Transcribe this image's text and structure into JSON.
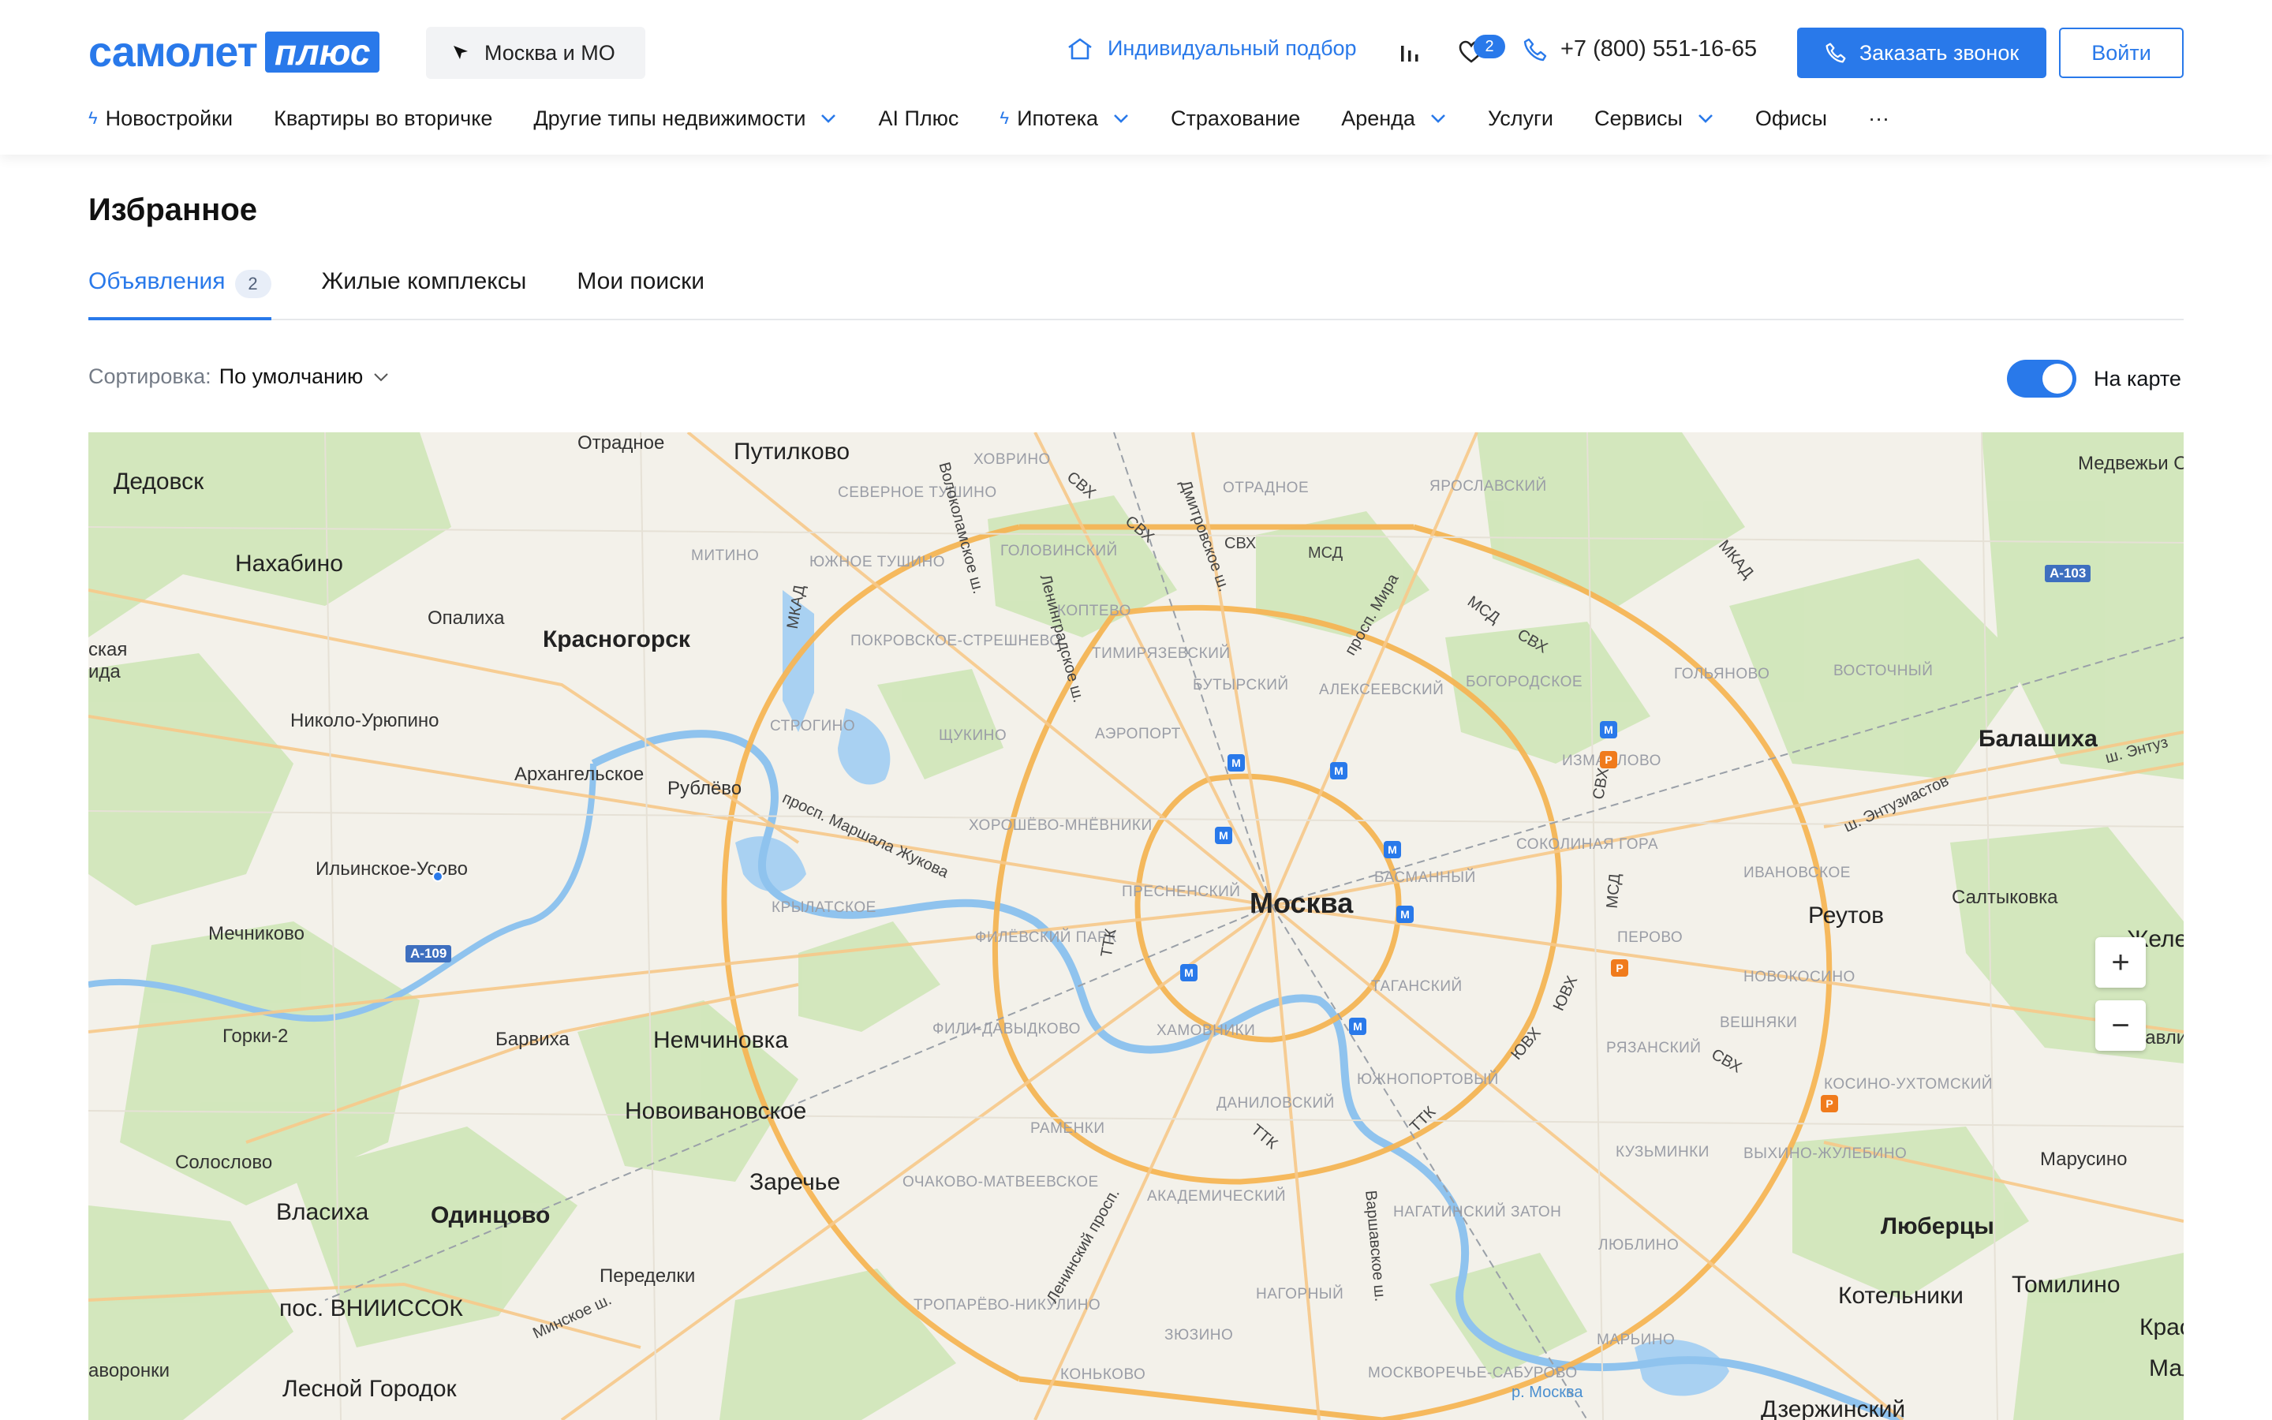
{
  "header": {
    "logo_text": "самолет",
    "logo_plus": "плюс",
    "region": "Москва и МО",
    "selection": "Индивидуальный подбор",
    "favorites_count": "2",
    "phone": "+7 (800) 551-16-65",
    "callback_label": "Заказать звонок",
    "login_label": "Войти",
    "brand_color": "#2979ea"
  },
  "nav": {
    "items": [
      {
        "label": "Новостройки",
        "bolt": true,
        "chevron": false
      },
      {
        "label": "Квартиры во вторичке",
        "bolt": false,
        "chevron": false
      },
      {
        "label": "Другие типы недвижимости",
        "bolt": false,
        "chevron": true
      },
      {
        "label": "AI Плюс",
        "bolt": false,
        "chevron": false
      },
      {
        "label": "Ипотека",
        "bolt": true,
        "chevron": true
      },
      {
        "label": "Страхование",
        "bolt": false,
        "chevron": false
      },
      {
        "label": "Аренда",
        "bolt": false,
        "chevron": true
      },
      {
        "label": "Услуги",
        "bolt": false,
        "chevron": false
      },
      {
        "label": "Сервисы",
        "bolt": false,
        "chevron": true
      },
      {
        "label": "Офисы",
        "bolt": false,
        "chevron": false
      }
    ],
    "more": "···"
  },
  "page": {
    "title": "Избранное",
    "tabs": [
      {
        "label": "Объявления",
        "count": "2",
        "active": true
      },
      {
        "label": "Жилые комплексы"
      },
      {
        "label": "Мои поиски"
      }
    ],
    "sort_label": "Сортировка:",
    "sort_value": "По умолчанию",
    "map_toggle_label": "На карте",
    "map_toggle_on": true
  },
  "map": {
    "center_city": "Москва",
    "zoom_in": "+",
    "zoom_out": "−",
    "labels": {
      "otradnoe_top": "Отрадное",
      "putilkovo": "Путилково",
      "dedovsk": "Дедовск",
      "nakhabino": "Нахабино",
      "opalikha": "Опалиха",
      "krasnogorsk": "Красногорск",
      "nikolo_uryupino": "Николо-Урюпино",
      "arkhangelskoe": "Архангельское",
      "rublevo": "Рублёво",
      "ilinskoe": "Ильинское-Усово",
      "mechnikovo": "Мечниково",
      "gorki2": "Горки-2",
      "barvikha": "Барвиха",
      "nemchinovka": "Немчиновка",
      "novoivanovskoe": "Новоивановское",
      "zarechye": "Заречье",
      "solslovo": "Солослово",
      "vlasikha": "Власиха",
      "odintsovo": "Одинцово",
      "peredelki": "Переделки",
      "vniissok": "пос. ВНИИССОК",
      "voronki": "аворонки",
      "lesnoy": "Лесной Городок",
      "skaya": "ская",
      "ida": "ида",
      "balashikha": "Балашиха",
      "reutov": "Реутов",
      "saltykovka": "Салтыковка",
      "lyubertsy": "Люберцы",
      "kotelniki": "Котельники",
      "tomilino": "Томилино",
      "marusino": "Марусино",
      "medvezhi": "Медвежьи О",
      "zheleznodor": "Железнод",
      "pavlino": "Павли",
      "kraskovo": "Красково",
      "malakh": "Мал",
      "dzerzh": "Дзержинский",
      "sevtushino": "СЕВЕРНОЕ ТУШИНО",
      "khovrino": "ХОВРИНО",
      "otradnoe": "ОТРАДНОЕ",
      "yaroslavsky": "ЯРОСЛАВСКИЙ",
      "mitino": "МИТИНО",
      "yuzhtushino": "ЮЖНОЕ ТУШИНО",
      "golovinsky": "ГОЛОВИНСКИЙ",
      "pokrovskoe": "ПОКРОВСКОЕ-СТРЕШНЕВО",
      "koptevo": "КОПТЕВО",
      "timiryazevsky": "ТИМИРЯЗЕВСКИЙ",
      "butyrsky": "БУТЫРСКИЙ",
      "alekseevsky": "АЛЕКСЕЕВСКИЙ",
      "bogorodskoe": "БОГОРОДСКОЕ",
      "golyanovo": "ГОЛЬЯНОВО",
      "vostochny": "ВОСТОЧНЫЙ",
      "strogino": "СТРОГИНО",
      "shchukino": "ЩУКИНО",
      "aeroport": "АЭРОПОРТ",
      "izmaylovo": "ИЗМАЙЛОВО",
      "khoroshevo": "ХОРОШЁВО-МНЁВНИКИ",
      "sokolinaya": "СОКОЛИНАЯ ГОРА",
      "ivanovskoe": "ИВАНОВСКОЕ",
      "krylatskoe": "КРЫЛАТСКОЕ",
      "presnensky": "ПРЕСНЕНСКИЙ",
      "basmanny": "БАСМАННЫЙ",
      "perovo": "ПЕРОВО",
      "filevsky": "ФИЛЁВСКИЙ ПАРК",
      "novokosino": "НОВОКОСИНО",
      "tagansky": "ТАГАНСКИЙ",
      "filidavydkovo": "ФИЛИ-ДАВЫДКОВО",
      "khamovniki": "ХАМОВНИКИ",
      "veshnyaki": "ВЕШНЯКИ",
      "ryazansky": "РЯЗАНСКИЙ",
      "yuzhnoport": "ЮЖНОПОРТОВЫЙ",
      "kosino": "КОСИНО-УХТОМСКИЙ",
      "danilovsky": "ДАНИЛОВСКИЙ",
      "ramenki": "РАМЕНКИ",
      "kuzminki": "КУЗЬМИНКИ",
      "vykhino": "ВЫХИНО-ЖУЛЕБИНО",
      "ochakovo": "ОЧАКОВО-МАТВЕЕВСКОЕ",
      "akademichesky": "АКАДЕМИЧЕСКИЙ",
      "nagatinsky": "НАГАТИНСКИЙ ЗАТОН",
      "lyublino": "ЛЮБЛИНО",
      "troparevo": "ТРОПАРЁВО-НИКУЛИНО",
      "nagorny": "НАГОРНЫЙ",
      "zyuzino": "ЗЮЗИНО",
      "maryino": "МАРЬИНО",
      "konkovo": "КОНЬКОВО",
      "moskvorechye": "МОСКВОРЕЧЬЕ-САБУРОВО",
      "mkad1": "МКАД",
      "mkad2": "МКАД",
      "mcd1": "МСД",
      "mcd2": "МСД",
      "mcd3": "МСД",
      "svh1": "СВХ",
      "svh2": "СВХ",
      "svh3": "СВХ",
      "svh4": "СВХ",
      "svh5": "СВХ",
      "svh6": "СВХ",
      "yuvkh1": "ЮВХ",
      "yuvkh2": "ЮВХ",
      "ttk1": "ТТК",
      "ttk2": "ТТК",
      "ttk3": "ТТК",
      "leningradka": "Ленинградское ш.",
      "dmitrovka": "Дмитровское ш.",
      "prmira": "просп. Мира",
      "zhukova": "просп. Маршала Жукова",
      "entuz": "ш. Энтузиастов",
      "entuz2": "ш. Энтуз",
      "volokolam": "Волоколамское ш.",
      "leninsky": "Ленинский просп.",
      "varshav": "Варшавское ш.",
      "minskoe": "Минское ш.",
      "moskva_river": "р. Москва",
      "a109": "А-109",
      "a103": "А-103"
    }
  }
}
